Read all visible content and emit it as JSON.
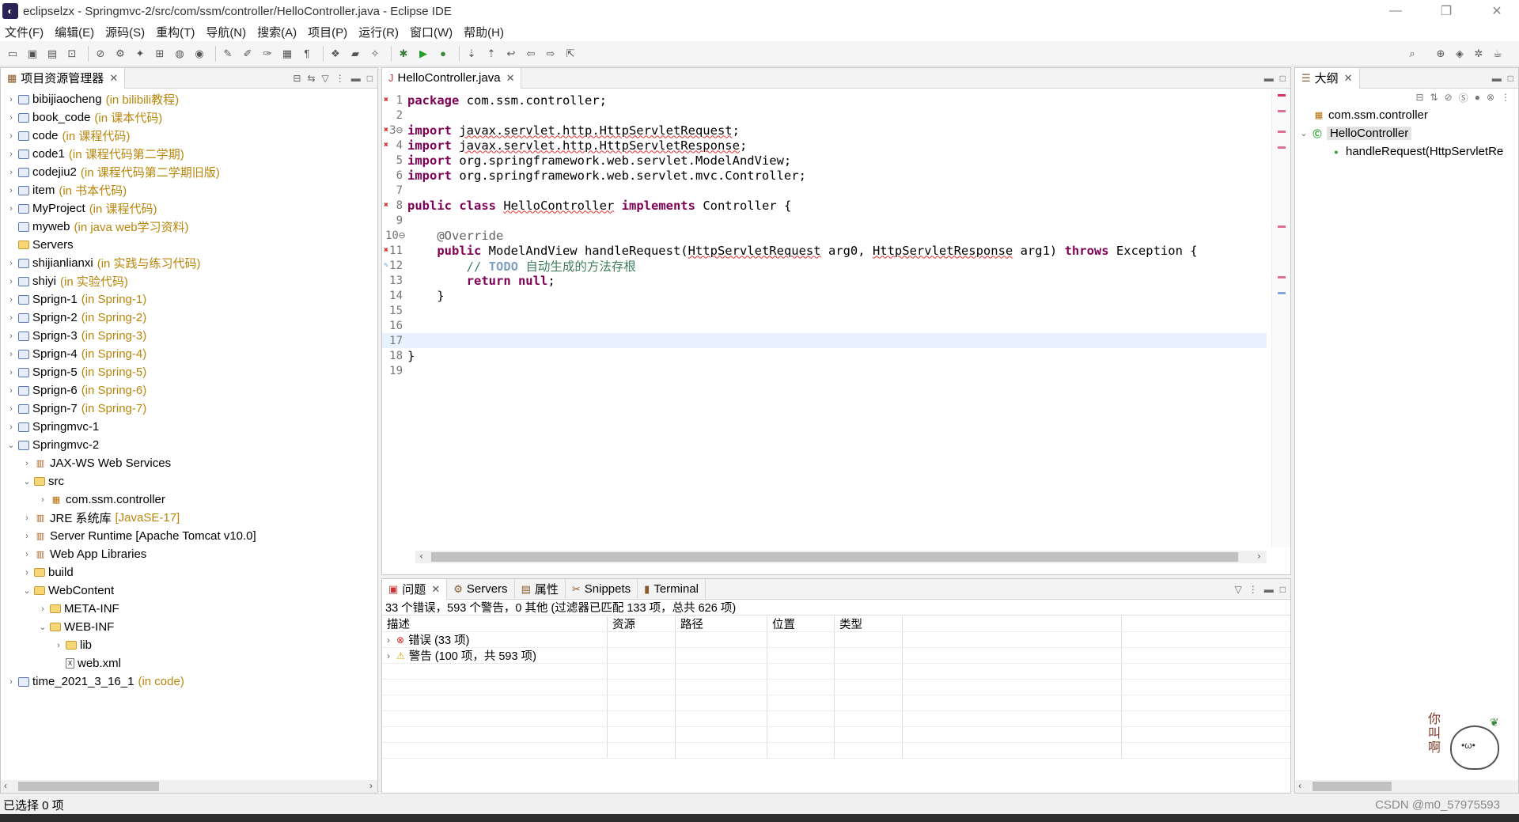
{
  "window": {
    "title": "eclipselzx - Springmvc-2/src/com/ssm/controller/HelloController.java - Eclipse IDE"
  },
  "menu": [
    "文件(F)",
    "编辑(E)",
    "源码(S)",
    "重构(T)",
    "导航(N)",
    "搜索(A)",
    "项目(P)",
    "运行(R)",
    "窗口(W)",
    "帮助(H)"
  ],
  "explorer": {
    "tab": "项目资源管理器",
    "items": [
      {
        "name": "bibijiaocheng",
        "deco": "(in bilibili教程)",
        "level": 0,
        "arrow": "›",
        "icon": "project"
      },
      {
        "name": "book_code",
        "deco": "(in 课本代码)",
        "level": 0,
        "arrow": "›",
        "icon": "project"
      },
      {
        "name": "code",
        "deco": "(in 课程代码)",
        "level": 0,
        "arrow": "›",
        "icon": "project"
      },
      {
        "name": "code1",
        "deco": "(in 课程代码第二学期)",
        "level": 0,
        "arrow": "›",
        "icon": "project"
      },
      {
        "name": "codejiu2",
        "deco": "(in 课程代码第二学期旧版)",
        "level": 0,
        "arrow": "›",
        "icon": "project"
      },
      {
        "name": "item",
        "deco": "(in 书本代码)",
        "level": 0,
        "arrow": "›",
        "icon": "project"
      },
      {
        "name": "MyProject",
        "deco": "(in 课程代码)",
        "level": 0,
        "arrow": "›",
        "icon": "project"
      },
      {
        "name": "myweb",
        "deco": "(in java web学习资料)",
        "level": 0,
        "arrow": "",
        "icon": "project"
      },
      {
        "name": "Servers",
        "deco": "",
        "level": 0,
        "arrow": "",
        "icon": "folder"
      },
      {
        "name": "shijianlianxi",
        "deco": "(in 实践与练习代码)",
        "level": 0,
        "arrow": "›",
        "icon": "project"
      },
      {
        "name": "shiyi",
        "deco": "(in 实验代码)",
        "level": 0,
        "arrow": "›",
        "icon": "project"
      },
      {
        "name": "Sprign-1",
        "deco": "(in Spring-1)",
        "level": 0,
        "arrow": "›",
        "icon": "project"
      },
      {
        "name": "Sprign-2",
        "deco": "(in Spring-2)",
        "level": 0,
        "arrow": "›",
        "icon": "project"
      },
      {
        "name": "Sprign-3",
        "deco": "(in Spring-3)",
        "level": 0,
        "arrow": "›",
        "icon": "project"
      },
      {
        "name": "Sprign-4",
        "deco": "(in Spring-4)",
        "level": 0,
        "arrow": "›",
        "icon": "project"
      },
      {
        "name": "Sprign-5",
        "deco": "(in Spring-5)",
        "level": 0,
        "arrow": "›",
        "icon": "project"
      },
      {
        "name": "Sprign-6",
        "deco": "(in Spring-6)",
        "level": 0,
        "arrow": "›",
        "icon": "project"
      },
      {
        "name": "Sprign-7",
        "deco": "(in Spring-7)",
        "level": 0,
        "arrow": "›",
        "icon": "project"
      },
      {
        "name": "Springmvc-1",
        "deco": "",
        "level": 0,
        "arrow": "›",
        "icon": "project"
      },
      {
        "name": "Springmvc-2",
        "deco": "",
        "level": 0,
        "arrow": "⌄",
        "icon": "project"
      },
      {
        "name": "JAX-WS Web Services",
        "deco": "",
        "level": 1,
        "arrow": "›",
        "icon": "lib"
      },
      {
        "name": "src",
        "deco": "",
        "level": 1,
        "arrow": "⌄",
        "icon": "folder"
      },
      {
        "name": "com.ssm.controller",
        "deco": "",
        "level": 2,
        "arrow": "›",
        "icon": "pkg"
      },
      {
        "name": "JRE 系统库",
        "deco": "[JavaSE-17]",
        "level": 1,
        "arrow": "›",
        "icon": "lib"
      },
      {
        "name": "Server Runtime [Apache Tomcat v10.0]",
        "deco": "",
        "level": 1,
        "arrow": "›",
        "icon": "lib"
      },
      {
        "name": "Web App Libraries",
        "deco": "",
        "level": 1,
        "arrow": "›",
        "icon": "lib"
      },
      {
        "name": "build",
        "deco": "",
        "level": 1,
        "arrow": "›",
        "icon": "folder"
      },
      {
        "name": "WebContent",
        "deco": "",
        "level": 1,
        "arrow": "⌄",
        "icon": "folder"
      },
      {
        "name": "META-INF",
        "deco": "",
        "level": 2,
        "arrow": "›",
        "icon": "folder"
      },
      {
        "name": "WEB-INF",
        "deco": "",
        "level": 2,
        "arrow": "⌄",
        "icon": "folder"
      },
      {
        "name": "lib",
        "deco": "",
        "level": 3,
        "arrow": "›",
        "icon": "folder"
      },
      {
        "name": "web.xml",
        "deco": "",
        "level": 3,
        "arrow": "",
        "icon": "file"
      },
      {
        "name": "time_2021_3_16_1",
        "deco": "(in code)",
        "level": 0,
        "arrow": "›",
        "icon": "project"
      }
    ]
  },
  "editor": {
    "tab": "HelloController.java",
    "lines": [
      {
        "n": "1",
        "html": "<span class=\"kw\">package</span> com.ssm.controller;"
      },
      {
        "n": "2",
        "html": ""
      },
      {
        "n": "3⊖",
        "html": "<span class=\"kw\">import</span> <span class=\"err\">javax.servlet.http.HttpServletRequest</span>;"
      },
      {
        "n": "4",
        "html": "<span class=\"kw\">import</span> <span class=\"err\">javax.servlet.http.HttpServletResponse</span>;"
      },
      {
        "n": "5",
        "html": "<span class=\"kw\">import</span> org.springframework.web.servlet.ModelAndView;"
      },
      {
        "n": "6",
        "html": "<span class=\"kw\">import</span> org.springframework.web.servlet.mvc.Controller;"
      },
      {
        "n": "7",
        "html": ""
      },
      {
        "n": "8",
        "html": "<span class=\"kw\">public class</span> <span class=\"err\">HelloController</span> <span class=\"kw\">implements</span> Controller {"
      },
      {
        "n": "9",
        "html": ""
      },
      {
        "n": "10⊖",
        "html": "    <span class=\"ann\">@Override</span>"
      },
      {
        "n": "11",
        "html": "    <span class=\"kw\">public</span> ModelAndView handleRequest(<span class=\"err\">HttpServletRequest</span> arg0, <span class=\"err\">HttpServletResponse</span> arg1) <span class=\"kw\">throws</span> Exception {"
      },
      {
        "n": "12",
        "html": "        <span class=\"cmt\">// </span><span class=\"todo\">TODO</span><span class=\"cmt\"> 自动生成的方法存根</span>"
      },
      {
        "n": "13",
        "html": "        <span class=\"kw\">return null</span>;"
      },
      {
        "n": "14",
        "html": "    }"
      },
      {
        "n": "15",
        "html": ""
      },
      {
        "n": "16",
        "html": ""
      },
      {
        "n": "17",
        "html": ""
      },
      {
        "n": "18",
        "html": "}"
      },
      {
        "n": "19",
        "html": ""
      }
    ]
  },
  "outline": {
    "tab": "大纲",
    "items": [
      "com.ssm.controller",
      "HelloController",
      "handleRequest(HttpServletRe"
    ]
  },
  "bottom": {
    "tabs": [
      "问题",
      "Servers",
      "属性",
      "Snippets",
      "Terminal"
    ],
    "summary": "33 个错误，593 个警告，0 其他 (过滤器已匹配 133 项，总共 626 项)",
    "columns": [
      "描述",
      "资源",
      "路径",
      "位置",
      "类型"
    ],
    "rows": [
      {
        "label": "错误 (33 项)",
        "kind": "error"
      },
      {
        "label": "警告 (100 项，共 593 项)",
        "kind": "warning"
      }
    ]
  },
  "status": {
    "text": "已选择 0 项"
  },
  "watermark": "CSDN @m0_57975593",
  "colors": {
    "keyword": "#7f0055",
    "comment": "#3f7f5f",
    "todo": "#7f9fbf",
    "deco": "#b8860b",
    "error": "#e03030"
  }
}
